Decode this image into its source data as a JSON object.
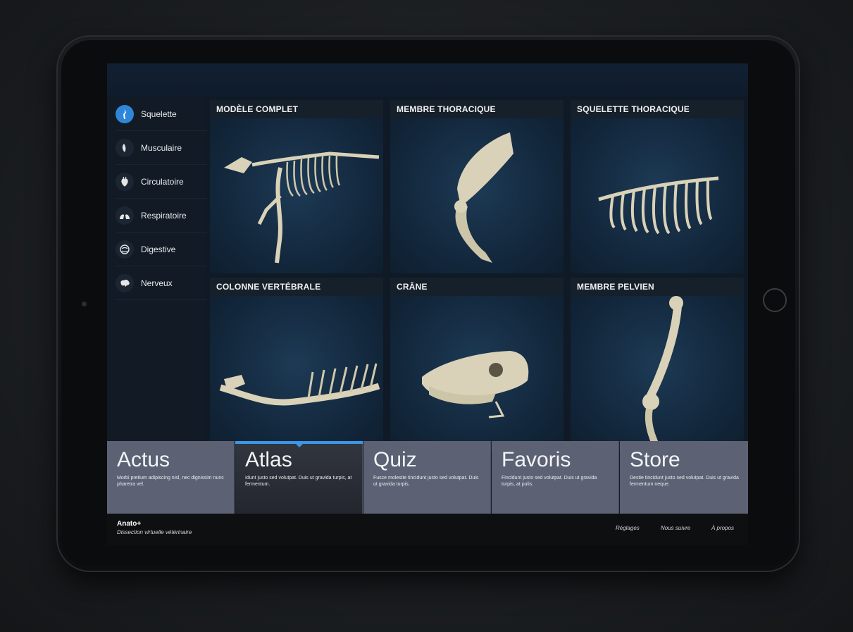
{
  "sidebar": {
    "items": [
      {
        "label": "Squelette",
        "icon": "bone-icon"
      },
      {
        "label": "Musculaire",
        "icon": "muscle-icon"
      },
      {
        "label": "Circulatoire",
        "icon": "heart-icon"
      },
      {
        "label": "Respiratoire",
        "icon": "lungs-icon"
      },
      {
        "label": "Digestive",
        "icon": "intestine-icon"
      },
      {
        "label": "Nerveux",
        "icon": "brain-icon"
      }
    ]
  },
  "grid": {
    "tiles": [
      {
        "title": "MODÈLE COMPLET"
      },
      {
        "title": "MEMBRE THORACIQUE"
      },
      {
        "title": "SQUELETTE THORACIQUE"
      },
      {
        "title": "COLONNE VERTÉBRALE"
      },
      {
        "title": "CRÂNE"
      },
      {
        "title": "MEMBRE PELVIEN"
      }
    ]
  },
  "tabs": [
    {
      "title": "Actus",
      "desc": "Morbi pretium adipiscing nisl, nec dignissim nunc pharetra vel."
    },
    {
      "title": "Atlas",
      "desc": "Idunt justo sed volutpat. Duis ut gravida turpis, at fermentum."
    },
    {
      "title": "Quiz",
      "desc": "Fusce molestie tincidunt justo sed volutpat. Duis ut gravida turpis."
    },
    {
      "title": "Favoris",
      "desc": "Fincidunt justo sed volutpat. Duis ut gravida turpis, at pulis."
    },
    {
      "title": "Store",
      "desc": "Destie tincidunt justo sed volutpat. Duis ut gravida fermentum neque."
    }
  ],
  "footer": {
    "brand": "Anato+",
    "subtitle": "Dissection virtuelle vétérinaire",
    "links": [
      "Réglages",
      "Nous suivre",
      "À propos"
    ]
  },
  "colors": {
    "accent": "#3b97e6",
    "tab_bg": "#5c6274",
    "bone": "#d9d2b8"
  }
}
